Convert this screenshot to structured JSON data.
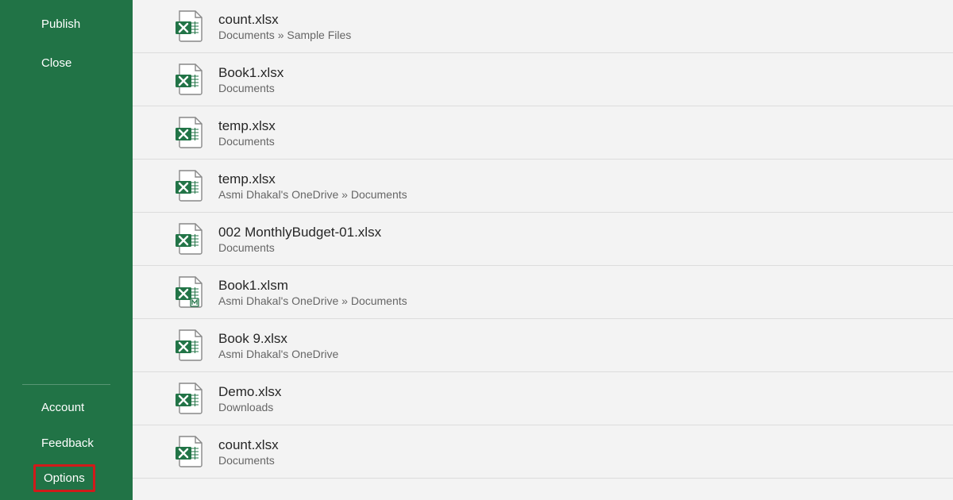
{
  "sidebar": {
    "top_items": [
      {
        "label": "Publish"
      },
      {
        "label": "Close"
      }
    ],
    "bottom_items": [
      {
        "label": "Account"
      },
      {
        "label": "Feedback"
      },
      {
        "label": "Options"
      }
    ]
  },
  "files": [
    {
      "name": "count.xlsx",
      "path": "Documents » Sample Files",
      "type": "xlsx"
    },
    {
      "name": "Book1.xlsx",
      "path": "Documents",
      "type": "xlsx"
    },
    {
      "name": "temp.xlsx",
      "path": "Documents",
      "type": "xlsx"
    },
    {
      "name": "temp.xlsx",
      "path": "Asmi Dhakal's OneDrive » Documents",
      "type": "xlsx"
    },
    {
      "name": "002 MonthlyBudget-01.xlsx",
      "path": "Documents",
      "type": "xlsx"
    },
    {
      "name": "Book1.xlsm",
      "path": "Asmi Dhakal's OneDrive » Documents",
      "type": "xlsm"
    },
    {
      "name": "Book 9.xlsx",
      "path": "Asmi Dhakal's OneDrive",
      "type": "xlsx"
    },
    {
      "name": "Demo.xlsx",
      "path": "Downloads",
      "type": "xlsx"
    },
    {
      "name": "count.xlsx",
      "path": "Documents",
      "type": "xlsx"
    }
  ],
  "colors": {
    "sidebar_bg": "#217346",
    "highlight_border": "#d11a1a",
    "excel_green": "#227447"
  }
}
